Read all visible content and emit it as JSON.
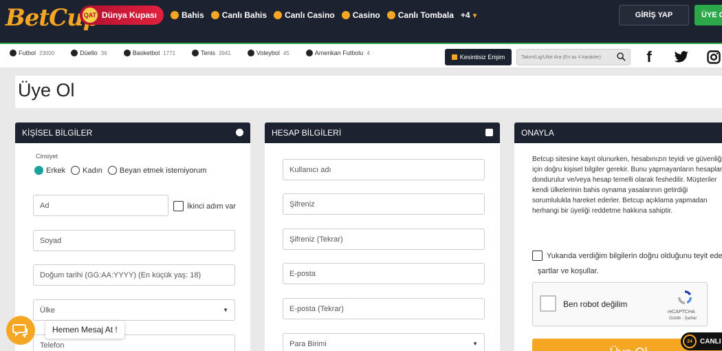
{
  "header": {
    "logo": "BetCup",
    "featured": {
      "badge": "QAT",
      "label": "Dünya Kupası"
    },
    "nav": [
      {
        "label": "Bahis"
      },
      {
        "label": "Canlı Bahis"
      },
      {
        "label": "Canlı Casino"
      },
      {
        "label": "Casino"
      },
      {
        "label": "Canlı Tombala"
      }
    ],
    "more": "+4",
    "login_label": "GİRİŞ YAP",
    "register_label": "ÜYE OL"
  },
  "sportsbar": {
    "sports": [
      {
        "label": "Futbol",
        "count": "23000"
      },
      {
        "label": "Düello",
        "count": "36"
      },
      {
        "label": "Basketbol",
        "count": "1771"
      },
      {
        "label": "Tenis",
        "count": "3941"
      },
      {
        "label": "Voleybol",
        "count": "45"
      },
      {
        "label": "Amerikan Futbolu",
        "count": "4"
      }
    ],
    "unlimited_label": "Kesintisiz Erişim",
    "search_placeholder": "Takım/Lig/Ülke Ara (En az 4 karakter)",
    "social": [
      "f",
      "t",
      "i"
    ]
  },
  "page": {
    "title": "Üye Ol"
  },
  "personal": {
    "header": "KİŞİSEL BİLGİLER",
    "gender_label": "Cinsiyet",
    "gender_options": [
      "Erkek",
      "Kadın",
      "Beyan etmek istemiyorum"
    ],
    "gender_selected": "Erkek",
    "first_name": "Ad",
    "second_name_label": "İkinci adım var",
    "last_name": "Soyad",
    "birthdate": "Doğum tarihi (GG:AA:YYYY) (En küçük yaş: 18)",
    "country": "Ülke",
    "phone": "Telefon"
  },
  "account": {
    "header": "HESAP BİLGİLERİ",
    "username": "Kullanıcı adı",
    "password": "Şifreniz",
    "password_repeat": "Şifreniz (Tekrar)",
    "email": "E-posta",
    "email_repeat": "E-posta (Tekrar)",
    "currency": "Para Birimi"
  },
  "confirm": {
    "header": "ONAYLA",
    "text": "Betcup sitesine kayıt olunurken, hesabınızın teyidi ve güvenliği için doğru kişisel bilgiler gerekir. Bunu yapmayanların hesapları dondurulur ve/veya hesap temelli olarak feshedilir. Müşteriler kendi ülkelerinin bahis oynama yasalarının getirdiği sorumlulukla hareket ederler. Betcup açıklama yapmadan herhangi bir üyeliği reddetme hakkına sahiptir.",
    "terms_line1": "Yukarıda verdiğim bilgilerin doğru olduğunu teyit ederim",
    "terms_line2": "şartlar ve koşullar.",
    "recaptcha_label": "Ben robot değilim",
    "recaptcha_brand": "reCAPTCHA",
    "recaptcha_links": "Gizlilik - Şartlar",
    "submit_label": "Üye Ol"
  },
  "chat": {
    "label": "Hemen Mesaj At !"
  },
  "live": {
    "badge": "24",
    "label": "CANLI"
  }
}
